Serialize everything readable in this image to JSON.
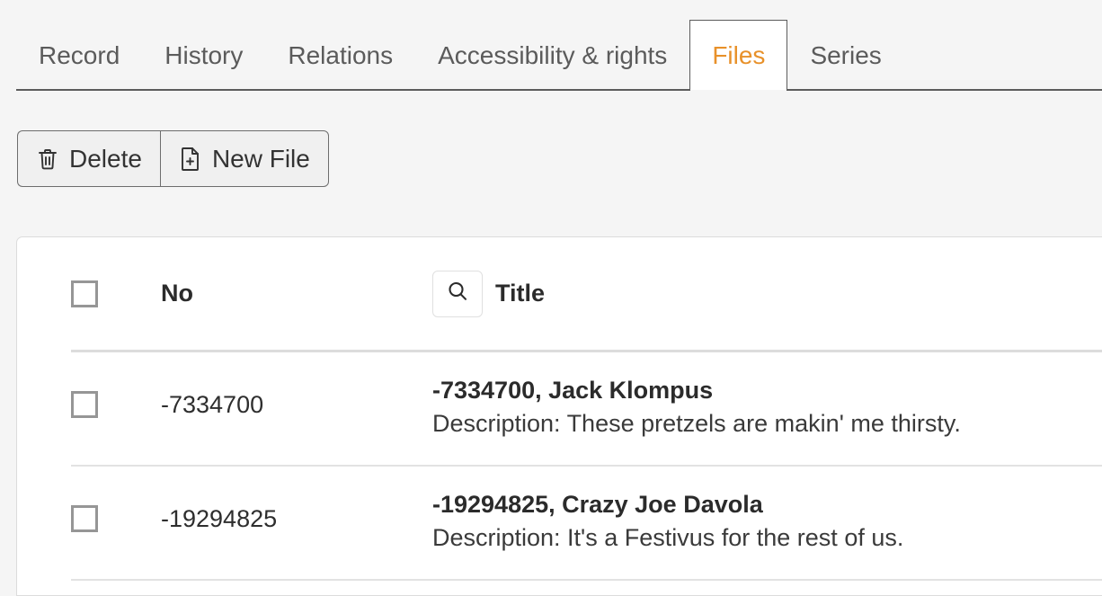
{
  "theme": {
    "background": "#f5f5f5",
    "panel_background": "#ffffff",
    "accent": "#e8912a",
    "border": "#5c5c5c",
    "row_divider": "#e2e2e2"
  },
  "tabs": [
    {
      "label": "Record",
      "active": false
    },
    {
      "label": "History",
      "active": false
    },
    {
      "label": "Relations",
      "active": false
    },
    {
      "label": "Accessibility & rights",
      "active": false
    },
    {
      "label": "Files",
      "active": true
    },
    {
      "label": "Series",
      "active": false
    }
  ],
  "toolbar": {
    "delete_label": "Delete",
    "delete_icon": "trash-icon",
    "new_file_label": "New File",
    "new_file_icon": "file-plus-icon"
  },
  "table": {
    "headers": {
      "select_all": "",
      "no": "No",
      "title": "Title",
      "search_icon": "search-icon"
    },
    "rows": [
      {
        "no": "-7334700",
        "title": "-7334700, Jack Klompus",
        "description": "Description: These pretzels are makin' me thirsty.",
        "selected": false
      },
      {
        "no": "-19294825",
        "title": "-19294825, Crazy Joe Davola",
        "description": "Description: It's a Festivus for the rest of us.",
        "selected": false
      }
    ]
  }
}
